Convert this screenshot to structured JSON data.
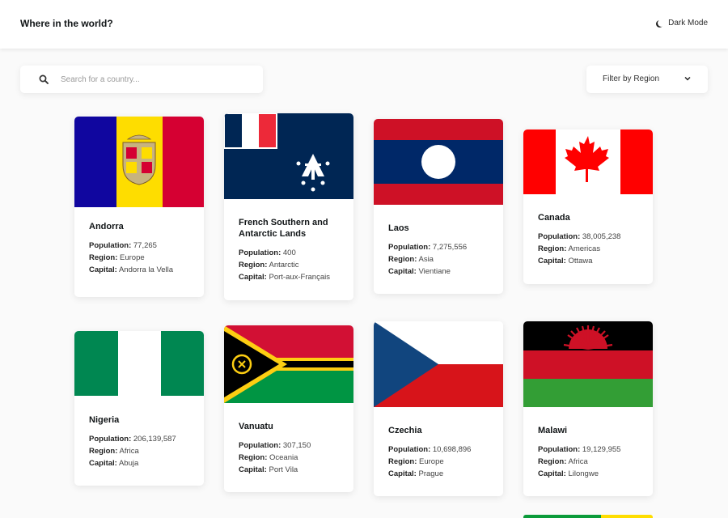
{
  "header": {
    "title": "Where in the world?",
    "mode_label": "Dark Mode"
  },
  "search": {
    "placeholder": "Search for a country..."
  },
  "filter": {
    "label": "Filter by Region"
  },
  "field_labels": {
    "population": "Population:",
    "region": "Region:",
    "capital": "Capital:"
  },
  "countries": [
    {
      "name": "Andorra",
      "population": "77,265",
      "region": "Europe",
      "capital": "Andorra la Vella",
      "flag_colors": [
        "#10069f",
        "#fedd00",
        "#d50032"
      ]
    },
    {
      "name": "French Southern and Antarctic Lands",
      "population": "400",
      "region": "Antarctic",
      "capital": "Port-aux-Français",
      "flag_colors": [
        "#002654",
        "#ffffff",
        "#ed2939"
      ]
    },
    {
      "name": "Laos",
      "population": "7,275,556",
      "region": "Asia",
      "capital": "Vientiane",
      "flag_colors": [
        "#ce1126",
        "#002868",
        "#ffffff"
      ]
    },
    {
      "name": "Canada",
      "population": "38,005,238",
      "region": "Americas",
      "capital": "Ottawa",
      "flag_colors": [
        "#ff0000",
        "#ffffff"
      ]
    },
    {
      "name": "Nigeria",
      "population": "206,139,587",
      "region": "Africa",
      "capital": "Abuja",
      "flag_colors": [
        "#008751",
        "#ffffff"
      ]
    },
    {
      "name": "Vanuatu",
      "population": "307,150",
      "region": "Oceania",
      "capital": "Port Vila",
      "flag_colors": [
        "#d21034",
        "#009543",
        "#000000",
        "#fdce12"
      ]
    },
    {
      "name": "Czechia",
      "population": "10,698,896",
      "region": "Europe",
      "capital": "Prague",
      "flag_colors": [
        "#ffffff",
        "#d7141a",
        "#11457e"
      ]
    },
    {
      "name": "Malawi",
      "population": "19,129,955",
      "region": "Africa",
      "capital": "Lilongwe",
      "flag_colors": [
        "#000000",
        "#ce1126",
        "#339e35"
      ]
    }
  ]
}
